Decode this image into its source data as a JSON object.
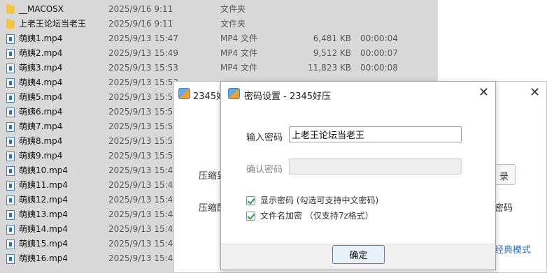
{
  "explorer": {
    "rows": [
      {
        "name": "__MACOSX",
        "date": "2025/9/16 9:11",
        "type": "文件夹",
        "size": "",
        "duration": "",
        "icon": "folder-icon"
      },
      {
        "name": "上老王论坛当老王",
        "date": "2025/9/16 9:11",
        "type": "文件夹",
        "size": "",
        "duration": "",
        "icon": "folder-icon"
      },
      {
        "name": "萌姨1.mp4",
        "date": "2025/9/13 15:47",
        "type": "MP4 文件",
        "size": "6,481 KB",
        "duration": "00:00:04",
        "icon": "video-file-icon"
      },
      {
        "name": "萌姨2.mp4",
        "date": "2025/9/13 15:49",
        "type": "MP4 文件",
        "size": "9,512 KB",
        "duration": "00:00:07",
        "icon": "video-file-icon"
      },
      {
        "name": "萌姨3.mp4",
        "date": "2025/9/13 15:53",
        "type": "MP4 文件",
        "size": "11,823 KB",
        "duration": "00:00:08",
        "icon": "video-file-icon"
      },
      {
        "name": "萌姨4.mp4",
        "date": "2025/9/13 15:53",
        "type": "",
        "size": "",
        "duration": "",
        "icon": "video-file-icon"
      },
      {
        "name": "萌姨5.mp4",
        "date": "2025/9/13 15:5",
        "type": "",
        "size": "",
        "duration": "",
        "icon": "video-file-icon"
      },
      {
        "name": "萌姨6.mp4",
        "date": "2025/9/13 15:5",
        "type": "",
        "size": "",
        "duration": "",
        "icon": "video-file-icon"
      },
      {
        "name": "萌姨7.mp4",
        "date": "2025/9/13 15:5",
        "type": "",
        "size": "",
        "duration": "",
        "icon": "video-file-icon"
      },
      {
        "name": "萌姨8.mp4",
        "date": "2025/9/13 15:5",
        "type": "",
        "size": "",
        "duration": "",
        "icon": "video-file-icon"
      },
      {
        "name": "萌姨9.mp4",
        "date": "2025/9/13 15:5",
        "type": "",
        "size": "",
        "duration": "",
        "icon": "video-file-icon"
      },
      {
        "name": "萌姨10.mp4",
        "date": "2025/9/13 15:4",
        "type": "",
        "size": "",
        "duration": "",
        "icon": "video-file-icon"
      },
      {
        "name": "萌姨11.mp4",
        "date": "2025/9/13 15:4",
        "type": "",
        "size": "",
        "duration": "",
        "icon": "video-file-icon"
      },
      {
        "name": "萌姨12.mp4",
        "date": "2025/9/13 15:4",
        "type": "",
        "size": "",
        "duration": "",
        "icon": "video-file-icon"
      },
      {
        "name": "萌姨13.mp4",
        "date": "2025/9/13 15:4",
        "type": "",
        "size": "",
        "duration": "",
        "icon": "video-file-icon"
      },
      {
        "name": "萌姨14.mp4",
        "date": "2025/9/13 15:4",
        "type": "",
        "size": "",
        "duration": "",
        "icon": "video-file-icon"
      },
      {
        "name": "萌姨15.mp4",
        "date": "2025/9/13 15:4",
        "type": "",
        "size": "",
        "duration": "",
        "icon": "video-file-icon"
      },
      {
        "name": "萌姨16.mp4",
        "date": "2025/9/13 15:4",
        "type": "",
        "size": "",
        "duration": "",
        "icon": "video-file-icon"
      }
    ]
  },
  "back_dialog": {
    "title": "2345好",
    "close_label": "✕",
    "label_compress_path": "压缩到",
    "label_compress_format": "压缩配",
    "browse_button_label": "录",
    "right_text": "密码",
    "classic_mode_link": "经典模式"
  },
  "password_dialog": {
    "title": "密码设置 - 2345好压",
    "close_label": "✕",
    "enter_password_label": "输入密码",
    "password_value": "上老王论坛当老王",
    "confirm_password_label": "确认密码",
    "show_password_label": "显示密码 (勾选可支持中文密码)",
    "encrypt_filenames_label": "文件名加密 （仅支持7z格式）",
    "ok_button_label": "确定"
  }
}
